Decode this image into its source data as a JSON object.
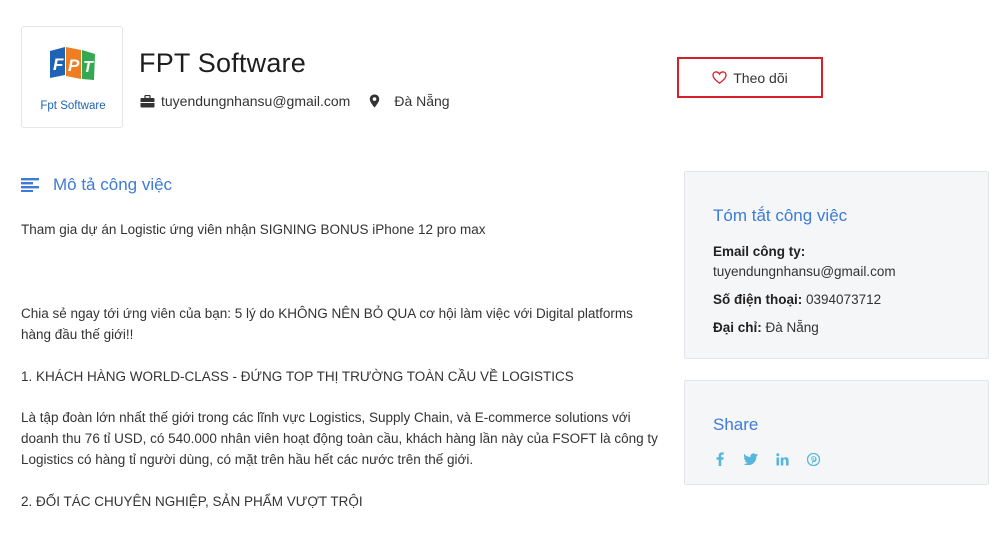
{
  "company": {
    "name": "FPT Software",
    "logo_text": "Fpt Software",
    "logo_letters": [
      "F",
      "P",
      "T"
    ],
    "email": "tuyendungnhansu@gmail.com",
    "location": "Đà Nẵng"
  },
  "follow_button": {
    "label": "Theo dõi"
  },
  "job_description": {
    "title": "Mô tả công việc",
    "paragraphs": [
      "Tham gia dự án Logistic ứng viên nhận SIGNING BONUS iPhone 12 pro max",
      "Chia sẻ ngay tới ứng viên của bạn: 5 lý do KHÔNG NÊN BỎ QUA cơ hội làm việc với Digital platforms hàng đầu thế giới!!",
      "1. KHÁCH HÀNG WORLD-CLASS - ĐỨNG TOP THỊ TRƯỜNG TOÀN CẦU VỀ LOGISTICS",
      "Là tập đoàn lớn nhất thế giới trong các lĩnh vực Logistics, Supply Chain, và E-commerce solutions với doanh thu 76 tỉ USD, có 540.000 nhân viên hoạt động toàn cầu, khách hàng lần này của FSOFT là công ty Logistics có hàng tỉ người dùng, có mặt trên hầu hết các nước trên thế giới.",
      "2. ĐỐI TÁC CHUYÊN NGHIỆP, SẢN PHẨM VƯỢT TRỘI"
    ]
  },
  "summary": {
    "title": "Tóm tắt công việc",
    "email_label": "Email công ty:",
    "email_value": "tuyendungnhansu@gmail.com",
    "phone_label": "Số điện thoại:",
    "phone_value": "0394073712",
    "address_label": "Đại chỉ:",
    "address_value": "Đà Nẵng"
  },
  "share": {
    "title": "Share",
    "icons": [
      "facebook-icon",
      "twitter-icon",
      "linkedin-icon",
      "pinterest-icon"
    ]
  },
  "colors": {
    "accent": "#3d7bd6",
    "highlight_border": "#d6202a",
    "share_icon": "#57b6dc",
    "card_bg": "#f5f6f8"
  }
}
